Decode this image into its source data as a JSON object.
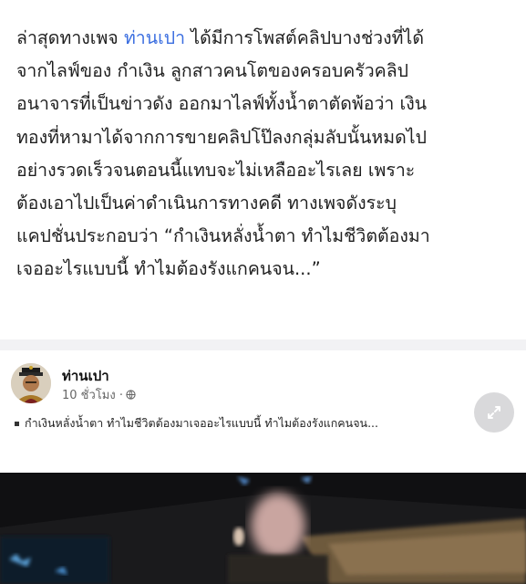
{
  "article": {
    "line1_before": "ล่าสุดทางเพจ ",
    "line1_link": "ท่านเปา",
    "line1_after": " ได้มีการโพสต์คลิปบางช่วงที่ได้",
    "line2": "จากไลฟ์ของ กำเงิน ลูกสาวคนโตของครอบครัวคลิป",
    "line3": "อนาจารที่เป็นข่าวดัง ออกมาไลฟ์ทั้งน้ำตาตัดพ้อว่า เงิน",
    "line4": "ทองที่หามาได้จากการขายคลิปโป๊ลงกลุ่มลับนั้นหมดไป",
    "line5": "อย่างรวดเร็วจนตอนนี้แทบจะไม่เหลืออะไรเลย เพราะ",
    "line6": "ต้องเอาไปเป็นค่าดำเนินการทางคดี ทางเพจดังระบุ",
    "line7": "แคปชั่นประกอบว่า “กำเงินหลั่งน้ำตา ทำไมชีวิตต้องมา",
    "line8": "เจออะไรแบบนี้ ทำไมต้องรังแกคนจน...”"
  },
  "post": {
    "author": "ท่านเปา",
    "time": "10 ชั่วโมง ·",
    "caption": "กำเงินหลั่งน้ำตา ทำไมชีวิตต้องมาเจออะไรแบบนี้  ทำไมต้องรังแกคนจน..."
  },
  "colors": {
    "link": "#3b6ee0",
    "text": "#1f1f1f",
    "band": "#f2f2f4"
  },
  "icons": {
    "globe": "globe-icon",
    "expand": "expand-icon",
    "avatar": "avatar"
  }
}
